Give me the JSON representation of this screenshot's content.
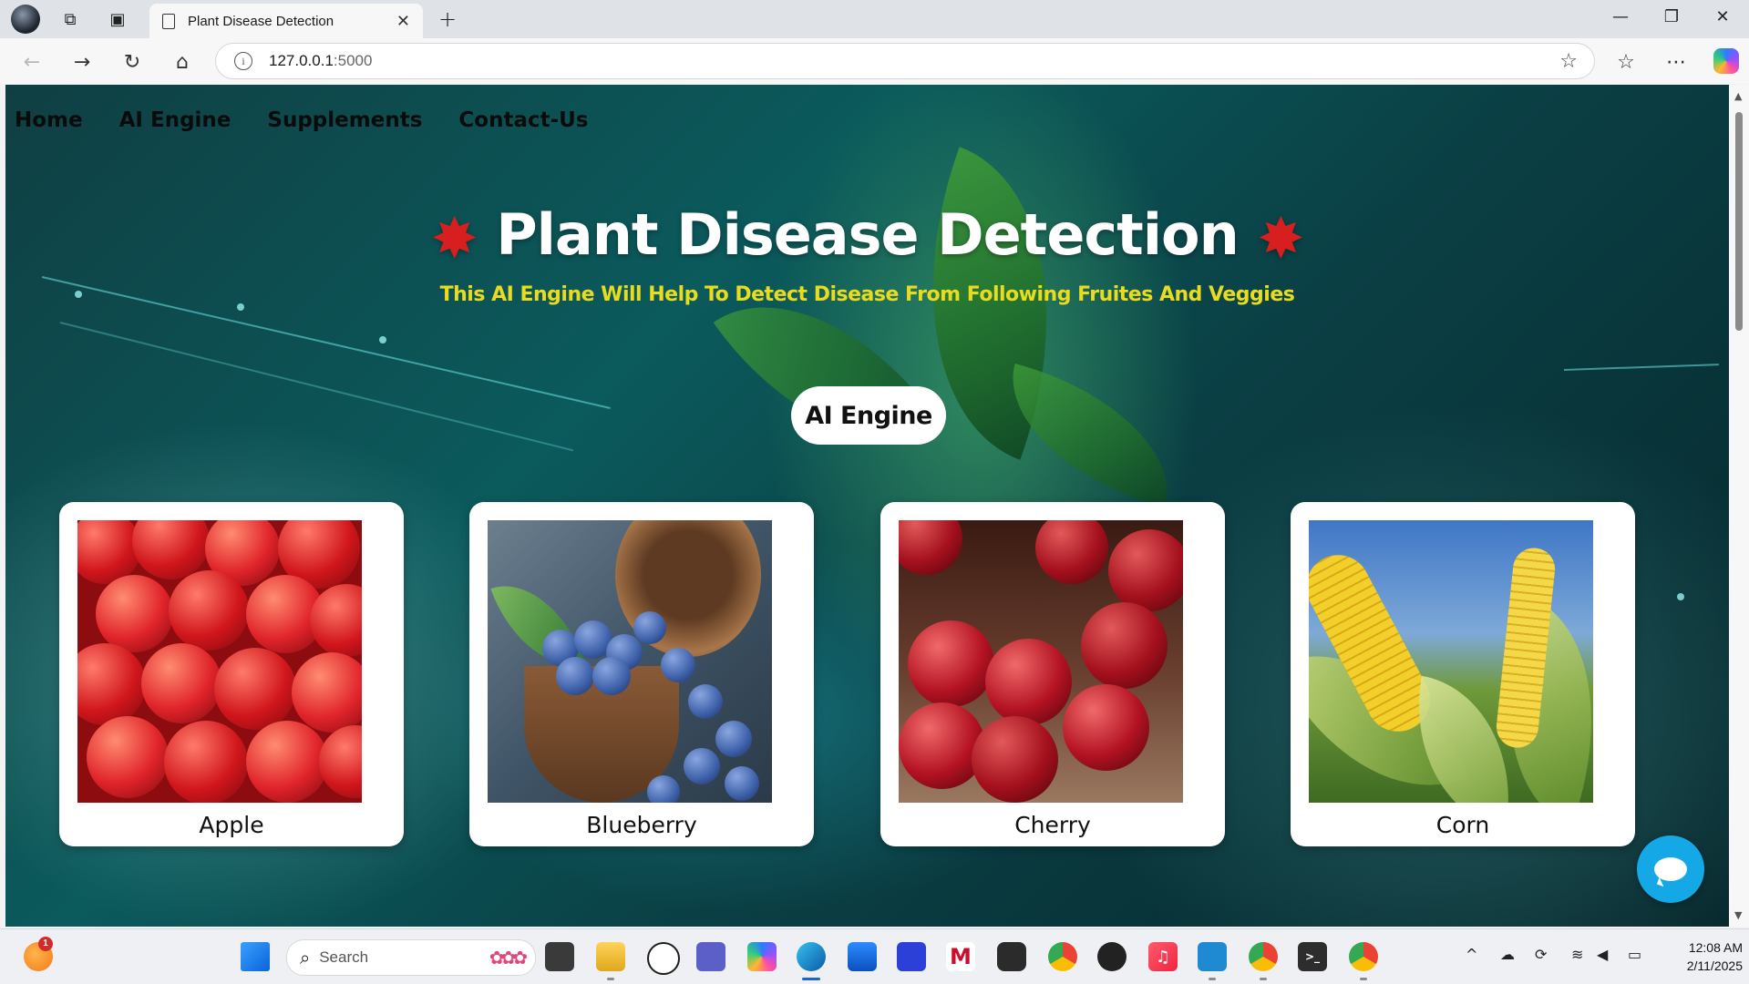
{
  "browser": {
    "tab_title": "Plant Disease Detection",
    "url_host": "127.0.0.1",
    "url_port": ":5000"
  },
  "nav": {
    "items": [
      {
        "label": "Home"
      },
      {
        "label": "AI Engine"
      },
      {
        "label": "Supplements"
      },
      {
        "label": "Contact-Us"
      }
    ]
  },
  "hero": {
    "title": "Plant Disease Detection",
    "subtitle": "This AI Engine Will Help To Detect Disease From Following Fruites And Veggies",
    "button_label": "AI Engine"
  },
  "cards": [
    {
      "label": "Apple",
      "color": "#d1161c"
    },
    {
      "label": "Blueberry",
      "color": "#3c5fa8"
    },
    {
      "label": "Cherry",
      "color": "#a4101d"
    },
    {
      "label": "Corn",
      "color": "#f2cf2a"
    }
  ],
  "taskbar": {
    "search_placeholder": "Search",
    "notification_count": "1",
    "time": "12:08 AM",
    "date": "2/11/2025"
  },
  "colors": {
    "title_text": "#ffffff",
    "subtitle_text": "#e9dc1f",
    "maple_leaf": "#d71f1f",
    "chat_button": "#14a9e6"
  }
}
